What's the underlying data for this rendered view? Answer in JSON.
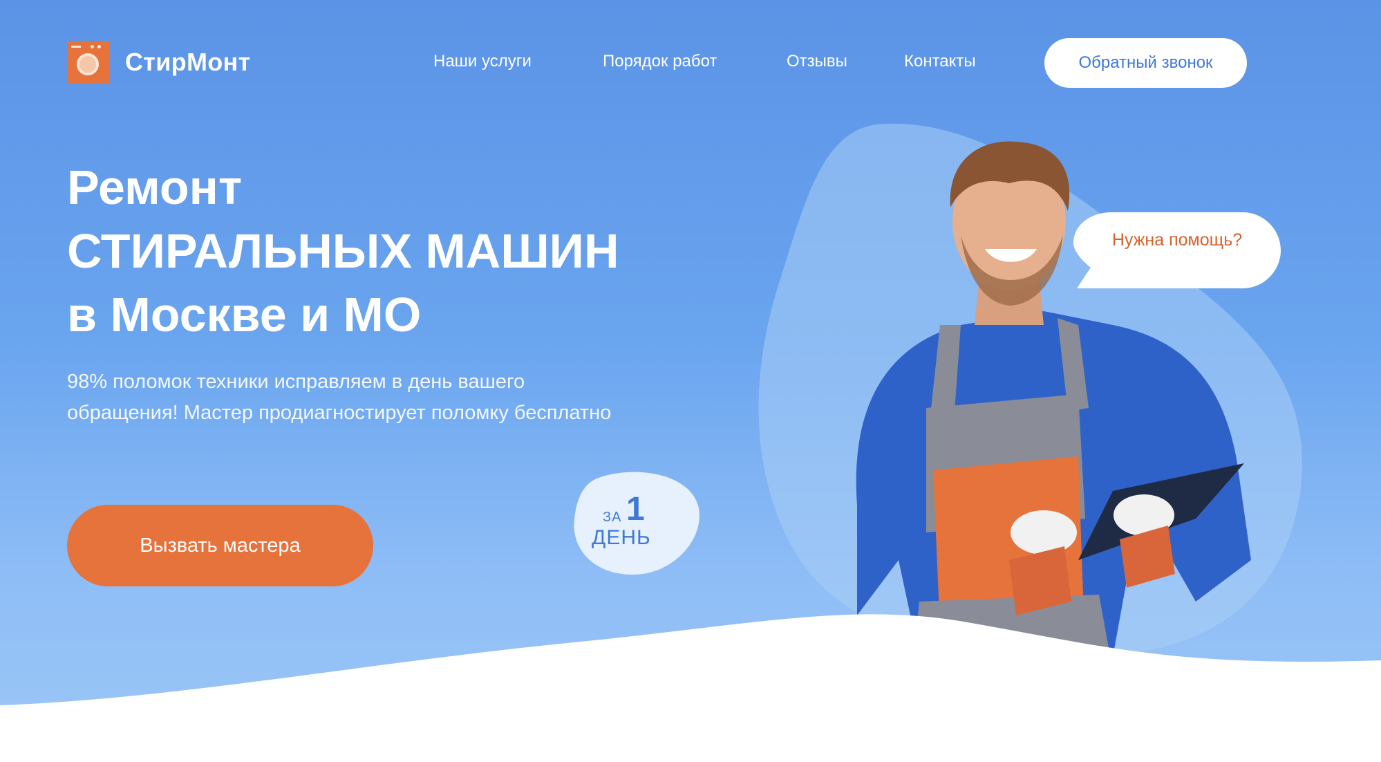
{
  "brand": {
    "name": "СтирМонт",
    "logo_icon": "washing-machine-icon",
    "accent": "#e5733b"
  },
  "nav": {
    "items": [
      {
        "label": "Наши услуги"
      },
      {
        "label": "Порядок работ"
      },
      {
        "label": "Отзывы"
      },
      {
        "label": "Контакты"
      }
    ],
    "callback_label": "Обратный звонок"
  },
  "hero": {
    "title_lines": [
      "Ремонт",
      "СТИРАЛЬНЫХ МАШИН",
      "в Москве и МО"
    ],
    "subtitle": "98% поломок техники исправляем в день вашего обращения! Мастер продиагностирует поломку бесплатно",
    "cta_label": "Вызвать мастера",
    "badge": {
      "za": "ЗА",
      "number": "1",
      "unit": "ДЕНЬ"
    },
    "bubble_text": "Нужна помощь?"
  },
  "colors": {
    "primary_blue": "#5b93e6",
    "button_text_blue": "#3f78d6",
    "orange": "#e5733b"
  }
}
